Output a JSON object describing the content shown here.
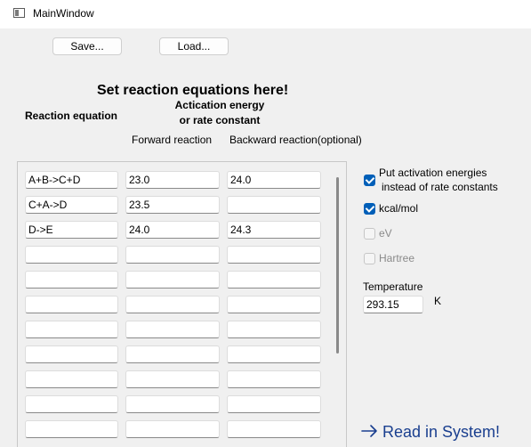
{
  "window": {
    "title": "MainWindow"
  },
  "toolbar": {
    "save_label": "Save...",
    "load_label": "Load..."
  },
  "header": {
    "title": "Set reaction equations here!",
    "col_equation": "Reaction equation",
    "col_energy_line1": "Actication energy",
    "col_energy_line2": "or rate constant",
    "col_forward": "Forward reaction",
    "col_backward": "Backward reaction(optional)"
  },
  "table": {
    "rows": [
      {
        "equation": "A+B->C+D",
        "forward": "23.0",
        "backward": "24.0"
      },
      {
        "equation": "C+A->D",
        "forward": "23.5",
        "backward": ""
      },
      {
        "equation": "D->E",
        "forward": "24.0",
        "backward": "24.3"
      },
      {
        "equation": "",
        "forward": "",
        "backward": ""
      },
      {
        "equation": "",
        "forward": "",
        "backward": ""
      },
      {
        "equation": "",
        "forward": "",
        "backward": ""
      },
      {
        "equation": "",
        "forward": "",
        "backward": ""
      },
      {
        "equation": "",
        "forward": "",
        "backward": ""
      },
      {
        "equation": "",
        "forward": "",
        "backward": ""
      },
      {
        "equation": "",
        "forward": "",
        "backward": ""
      },
      {
        "equation": "",
        "forward": "",
        "backward": ""
      }
    ]
  },
  "options": {
    "use_activation_line1": "Put activation energies",
    "use_activation_line2": "instead of rate constants",
    "use_activation_checked": true,
    "kcal_label": "kcal/mol",
    "kcal_checked": true,
    "ev_label": "eV",
    "ev_checked": false,
    "hartree_label": "Hartree",
    "hartree_checked": false
  },
  "temperature": {
    "label": "Temperature",
    "value": "293.15",
    "unit": "K"
  },
  "actions": {
    "read_label": "Read in System!",
    "icon": "arrow-right-icon"
  },
  "colors": {
    "accent": "#005fb8",
    "link": "#1a3f8f"
  }
}
